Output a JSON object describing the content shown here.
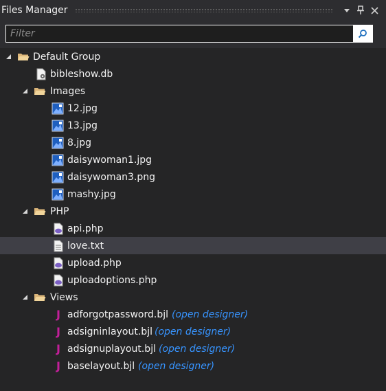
{
  "panel": {
    "title": "Files Manager",
    "buttons": {
      "dropdown": "▾",
      "pin": "⊥",
      "close": "✕"
    }
  },
  "search": {
    "placeholder": "Filter",
    "value": ""
  },
  "tree": {
    "root": {
      "label": "Default Group",
      "icon": "folder-open-icon"
    },
    "db": {
      "label": "bibleshow.db",
      "icon": "database-file-icon"
    },
    "images": {
      "label": "Images",
      "items": [
        "12.jpg",
        "13.jpg",
        "8.jpg",
        "daisywoman1.jpg",
        "daisywoman3.png",
        "mashy.jpg"
      ]
    },
    "php": {
      "label": "PHP",
      "items": [
        {
          "label": "api.php",
          "icon": "php-file-icon"
        },
        {
          "label": "love.txt",
          "icon": "text-file-icon",
          "selected": true
        },
        {
          "label": "upload.php",
          "icon": "php-file-icon"
        },
        {
          "label": "uploadoptions.php",
          "icon": "php-file-icon"
        }
      ]
    },
    "views": {
      "label": "Views",
      "items": [
        {
          "label": "adforgotpassword.bjl",
          "link": "(open designer)"
        },
        {
          "label": "adsigninlayout.bjl",
          "link": "(open designer)"
        },
        {
          "label": "adsignuplayout.bjl",
          "link": "(open designer)"
        },
        {
          "label": "baselayout.bjl",
          "link": "(open designer)"
        }
      ]
    }
  },
  "colors": {
    "background": "#252526",
    "header": "#2d2d30",
    "selection": "#3f3f46",
    "link": "#3794ff",
    "bjl_icon": "#c21f99",
    "folder": "#dcb67a"
  }
}
